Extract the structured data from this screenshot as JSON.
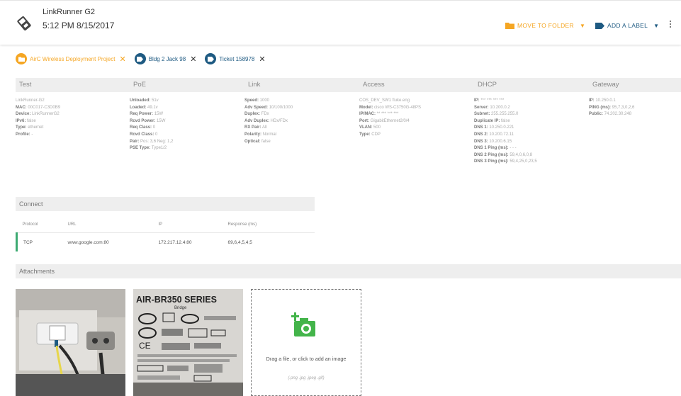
{
  "header": {
    "device_name": "LinkRunner G2",
    "datetime": "5:12 PM  8/15/2017",
    "move_to_folder": "MOVE TO FOLDER",
    "add_label": "ADD A LABEL"
  },
  "chips": [
    {
      "label": "AirC Wireless Deployment Project",
      "color": "#f5a623"
    },
    {
      "label": "Bldg 2 Jack 98",
      "color": "#1e5a82"
    },
    {
      "label": "Ticket 158978",
      "color": "#1e5a82"
    }
  ],
  "test": {
    "title": "Test",
    "lines": [
      {
        "k": "",
        "v": "LinkRunner-G2"
      },
      {
        "k": "MAC:",
        "v": "00C017-C3D0B9"
      },
      {
        "k": "Device:",
        "v": "LinkRunnerG2"
      },
      {
        "k": "IPv6:",
        "v": "false"
      },
      {
        "k": "Type:",
        "v": "ethernet"
      },
      {
        "k": "Profile:",
        "v": "-"
      }
    ]
  },
  "poe": {
    "title": "PoE",
    "lines": [
      {
        "k": "Unloaded:",
        "v": "51v"
      },
      {
        "k": "Loaded:",
        "v": "49.1v"
      },
      {
        "k": "Req Power:",
        "v": "15W"
      },
      {
        "k": "Rcvd Power:",
        "v": "15W"
      },
      {
        "k": "Req Class:",
        "v": "0"
      },
      {
        "k": "Rcvd Class:",
        "v": "0"
      },
      {
        "k": "Pair:",
        "v": "Pos: 3,6 Neg: 1,2"
      },
      {
        "k": "PSE Type:",
        "v": "Type1/2"
      }
    ]
  },
  "link": {
    "title": "Link",
    "lines": [
      {
        "k": "Speed:",
        "v": "1000"
      },
      {
        "k": "Adv Speed:",
        "v": "10/100/1000"
      },
      {
        "k": "Duplex:",
        "v": "FDx"
      },
      {
        "k": "Adv Duplex:",
        "v": "HDx/FDx"
      },
      {
        "k": "RX Pair:",
        "v": "All"
      },
      {
        "k": "Polarity:",
        "v": "Normal"
      },
      {
        "k": "Optical:",
        "v": "false"
      }
    ]
  },
  "access": {
    "title": "Access",
    "lines": [
      {
        "k": "",
        "v": "COS_DEV_SW1 fluke.eng"
      },
      {
        "k": "Model:",
        "v": "cisco WS-C3750G-48PS"
      },
      {
        "k": "IP/MAC:",
        "v": "** *** *** ***"
      },
      {
        "k": "Port:",
        "v": "GigabitEthernet2/0/4"
      },
      {
        "k": "VLAN:",
        "v": "500"
      },
      {
        "k": "Type:",
        "v": "CDP"
      }
    ]
  },
  "dhcp": {
    "title": "DHCP",
    "lines": [
      {
        "k": "IP:",
        "v": "*** *** *** ***"
      },
      {
        "k": "Server:",
        "v": "10.200.0.2"
      },
      {
        "k": "Subnet:",
        "v": "255.255.255.0"
      },
      {
        "k": "Duplicate IP:",
        "v": "false"
      },
      {
        "k": "DNS 1:",
        "v": "10.250.0.221"
      },
      {
        "k": "DNS 2:",
        "v": "10.200.72.11"
      },
      {
        "k": "DNS 3:",
        "v": "10.200.6.15"
      },
      {
        "k": "DNS 1 Ping (ms):",
        "v": "- - -"
      },
      {
        "k": "DNS 2 Ping (ms):",
        "v": "59,4,0,6,0,8"
      },
      {
        "k": "DNS 3 Ping (ms):",
        "v": "59,4,25,0,23,5"
      }
    ]
  },
  "gateway": {
    "title": "Gateway",
    "lines": [
      {
        "k": "IP:",
        "v": "10.250.0.1"
      },
      {
        "k": "PING (ms):",
        "v": "95,7,3,0,2,6"
      },
      {
        "k": "Public:",
        "v": "74.202.30.248"
      }
    ]
  },
  "connect": {
    "title": "Connect",
    "headers": [
      "Protocol",
      "URL",
      "IP",
      "Response (ms)"
    ],
    "rows": [
      {
        "protocol": "TCP",
        "url": "www.google.com:80",
        "ip": "172.217.12.4:80",
        "response": "69,6,4,5,4,5"
      }
    ]
  },
  "attachments": {
    "title": "Attachments",
    "label_text": "AIR-BR350 SERIES",
    "label_sub": "Bridge",
    "drop_text": "Drag a file, or click to add an image",
    "drop_sub": "(.png .jpg .jpeg .gif)"
  },
  "colors": {
    "accent_orange": "#f5a623",
    "navy": "#1e5a82",
    "green": "#43b44a",
    "row_green": "#3daa72"
  }
}
